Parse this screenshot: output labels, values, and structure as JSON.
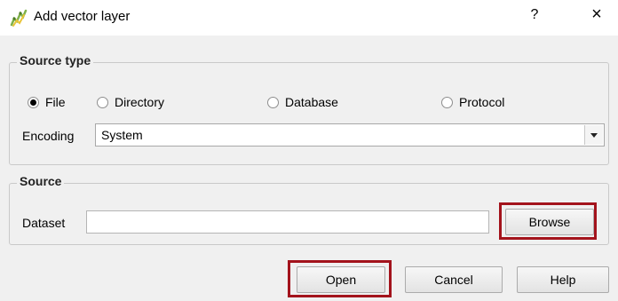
{
  "window": {
    "title": "Add vector layer",
    "help_glyph": "?",
    "close_glyph": "×"
  },
  "source_type": {
    "group_title": "Source type",
    "options": [
      {
        "label": "File",
        "selected": true
      },
      {
        "label": "Directory",
        "selected": false
      },
      {
        "label": "Database",
        "selected": false
      },
      {
        "label": "Protocol",
        "selected": false
      }
    ],
    "encoding_label": "Encoding",
    "encoding_value": "System"
  },
  "source": {
    "group_title": "Source",
    "dataset_label": "Dataset",
    "dataset_value": "",
    "browse_label": "Browse"
  },
  "buttons": {
    "open": "Open",
    "cancel": "Cancel",
    "help": "Help"
  },
  "colors": {
    "highlight": "#a3131c",
    "icon_green": "#7fb24a",
    "icon_yellow": "#e9c437"
  }
}
